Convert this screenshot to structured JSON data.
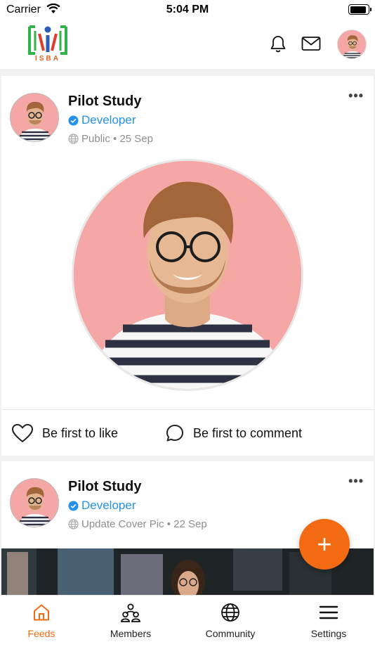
{
  "status_bar": {
    "carrier": "Carrier",
    "time": "5:04 PM",
    "battery_level": 0.9
  },
  "app_bar": {
    "logo_text": "ISBA"
  },
  "colors": {
    "accent": "#f26b12",
    "verified": "#2491eb",
    "avatar_bg": "#f5a7a6"
  },
  "posts": [
    {
      "author": "Pilot Study",
      "role": "Developer",
      "meta": "Public • 25 Sep",
      "like_label": "Be first to like",
      "comment_label": "Be first to comment"
    },
    {
      "author": "Pilot Study",
      "role": "Developer",
      "meta": "Update Cover Pic • 22 Sep"
    }
  ],
  "fab": {
    "label": "+"
  },
  "tabs": [
    {
      "label": "Feeds",
      "icon": "home-icon",
      "active": true
    },
    {
      "label": "Members",
      "icon": "members-icon",
      "active": false
    },
    {
      "label": "Community",
      "icon": "globe-icon",
      "active": false
    },
    {
      "label": "Settings",
      "icon": "menu-icon",
      "active": false
    }
  ]
}
